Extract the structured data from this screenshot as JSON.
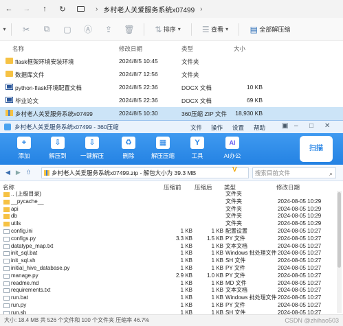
{
  "explorer": {
    "path": [
      "乡村老人关爱服务系统x07499"
    ],
    "toolbar": {
      "sort": "排序",
      "view": "查看",
      "extract_all": "全部解压缩"
    },
    "columns": {
      "name": "名称",
      "modified": "修改日期",
      "type": "类型",
      "size": "大小"
    },
    "files": [
      {
        "name": "flask框架环境安装环境",
        "modified": "2024/8/5 10:45",
        "type": "文件夹",
        "size": "",
        "kind": "folder"
      },
      {
        "name": "数据库文件",
        "modified": "2024/8/7 12:56",
        "type": "文件夹",
        "size": "",
        "kind": "folder"
      },
      {
        "name": "python-flask环境配置文档",
        "modified": "2024/8/5 22:36",
        "type": "DOCX 文档",
        "size": "10 KB",
        "kind": "doc"
      },
      {
        "name": "毕业论文",
        "modified": "2024/8/5 22:36",
        "type": "DOCX 文档",
        "size": "69 KB",
        "kind": "doc"
      },
      {
        "name": "乡村老人关爱服务系统x07499",
        "modified": "2024/8/5 10:30",
        "type": "360压缩 ZIP 文件",
        "size": "18,930 KB",
        "kind": "zip",
        "selected": true
      }
    ]
  },
  "zip": {
    "title": "乡村老人关爱服务系统x07499 - 360压缩",
    "menu": [
      "文件",
      "操作",
      "设置",
      "帮助"
    ],
    "window_controls": [
      "▣",
      "–",
      "□",
      "✕"
    ],
    "ribbon": [
      {
        "label": "添加",
        "icon": "+"
      },
      {
        "label": "解压到",
        "icon": "⇩"
      },
      {
        "label": "一键解压",
        "icon": "⇩"
      },
      {
        "label": "删除",
        "icon": "♻"
      },
      {
        "label": "解压压缩",
        "icon": "▦"
      },
      {
        "label": "工具",
        "icon": "Y"
      },
      {
        "label": "AI办公",
        "icon": "AI"
      }
    ],
    "scan_label": "扫描",
    "address": "乡村老人关爱服务系统x07499.zip - 解包大小为 39.3 MB",
    "search_placeholder": "搜索目前文件",
    "columns": {
      "name": "名称",
      "packed": "压缩前",
      "compressed": "压缩后",
      "type": "类型",
      "modified": "修改日期"
    },
    "files": [
      {
        "name": ".. (上级目录)",
        "packed": "",
        "compressed": "",
        "type": "文件夹",
        "modified": "",
        "kind": "f"
      },
      {
        "name": "__pycache__",
        "packed": "",
        "compressed": "",
        "type": "文件夹",
        "modified": "2024-08-05 10:29",
        "kind": "f"
      },
      {
        "name": "api",
        "packed": "",
        "compressed": "",
        "type": "文件夹",
        "modified": "2024-08-05 10:29",
        "kind": "f"
      },
      {
        "name": "db",
        "packed": "",
        "compressed": "",
        "type": "文件夹",
        "modified": "2024-08-05 10:29",
        "kind": "f"
      },
      {
        "name": "utils",
        "packed": "",
        "compressed": "",
        "type": "文件夹",
        "modified": "2024-08-05 10:29",
        "kind": "f"
      },
      {
        "name": "config.ini",
        "packed": "1 KB",
        "compressed": "1 KB",
        "type": "配置设置",
        "modified": "2024-08-05 10:27",
        "kind": "d"
      },
      {
        "name": "configs.py",
        "packed": "3.3 KB",
        "compressed": "1.5 KB",
        "type": "PY 文件",
        "modified": "2024-08-05 10:27",
        "kind": "d"
      },
      {
        "name": "datatype_map.txt",
        "packed": "1 KB",
        "compressed": "1 KB",
        "type": "文本文档",
        "modified": "2024-08-05 10:27",
        "kind": "d"
      },
      {
        "name": "init_sql.bat",
        "packed": "1 KB",
        "compressed": "1 KB",
        "type": "Windows 批处理文件",
        "modified": "2024-08-05 10:27",
        "kind": "d"
      },
      {
        "name": "init_sql.sh",
        "packed": "1 KB",
        "compressed": "1 KB",
        "type": "SH 文件",
        "modified": "2024-08-05 10:27",
        "kind": "d"
      },
      {
        "name": "initial_hive_database.py",
        "packed": "1 KB",
        "compressed": "1 KB",
        "type": "PY 文件",
        "modified": "2024-08-05 10:27",
        "kind": "d"
      },
      {
        "name": "manage.py",
        "packed": "2.9 KB",
        "compressed": "1.0 KB",
        "type": "PY 文件",
        "modified": "2024-08-05 10:27",
        "kind": "d"
      },
      {
        "name": "readme.md",
        "packed": "1 KB",
        "compressed": "1 KB",
        "type": "MD 文件",
        "modified": "2024-08-05 10:27",
        "kind": "d"
      },
      {
        "name": "requirements.txt",
        "packed": "1 KB",
        "compressed": "1 KB",
        "type": "文本文档",
        "modified": "2024-08-05 10:27",
        "kind": "d"
      },
      {
        "name": "run.bat",
        "packed": "1 KB",
        "compressed": "1 KB",
        "type": "Windows 批处理文件",
        "modified": "2024-08-05 10:27",
        "kind": "d"
      },
      {
        "name": "run.py",
        "packed": "1 KB",
        "compressed": "1 KB",
        "type": "PY 文件",
        "modified": "2024-08-05 10:27",
        "kind": "d"
      },
      {
        "name": "run.sh",
        "packed": "1 KB",
        "compressed": "1 KB",
        "type": "SH 文件",
        "modified": "2024-08-05 10:27",
        "kind": "d"
      }
    ],
    "status": "大小: 18.4 MB 共 526 个文件和 100 个文件夹 压缩率 46.7%",
    "watermark": "CSDN @zhihao503"
  }
}
